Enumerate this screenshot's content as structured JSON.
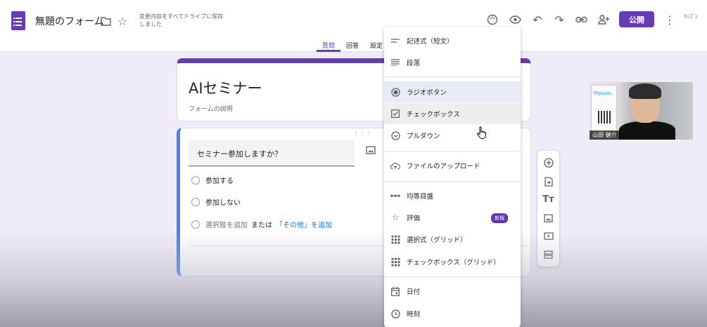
{
  "header": {
    "form_title": "無題のフォーム",
    "save_status": "変更内容をすべてドライブに保存しました",
    "publish_label": "公開",
    "account_label": "ﾘｯﾌﾟﾝ"
  },
  "tabs": [
    {
      "label": "質問",
      "active": true
    },
    {
      "label": "回答",
      "active": false
    },
    {
      "label": "設定",
      "active": false
    }
  ],
  "form": {
    "title": "AIセミナー",
    "description": "フォームの説明"
  },
  "question": {
    "text": "セミナー参加しますか？",
    "options": [
      "参加する",
      "参加しない"
    ],
    "add_option": "選択肢を追加",
    "or_text": "または",
    "add_other": "「その他」を追加"
  },
  "menu": {
    "items": [
      {
        "label": "記述式（短文）",
        "icon": "short-answer-icon"
      },
      {
        "label": "段落",
        "icon": "paragraph-icon"
      },
      {
        "label": "ラジオボタン",
        "icon": "radio-icon",
        "selected": true
      },
      {
        "label": "チェックボックス",
        "icon": "checkbox-icon"
      },
      {
        "label": "プルダウン",
        "icon": "dropdown-icon"
      },
      {
        "label": "ファイルのアップロード",
        "icon": "cloud-upload-icon"
      },
      {
        "label": "均等目盛",
        "icon": "linear-scale-icon"
      },
      {
        "label": "評価",
        "icon": "star-icon",
        "badge": "新規"
      },
      {
        "label": "選択式（グリッド）",
        "icon": "grid-icon"
      },
      {
        "label": "チェックボックス（グリッド）",
        "icon": "grid-check-icon"
      },
      {
        "label": "日付",
        "icon": "calendar-icon"
      },
      {
        "label": "時刻",
        "icon": "clock-icon"
      }
    ]
  },
  "video": {
    "brand": "TPplants",
    "name": "山田 健介"
  },
  "colors": {
    "accent": "#673ab7",
    "question_border": "#4285f4",
    "background": "#f0ebf8"
  }
}
